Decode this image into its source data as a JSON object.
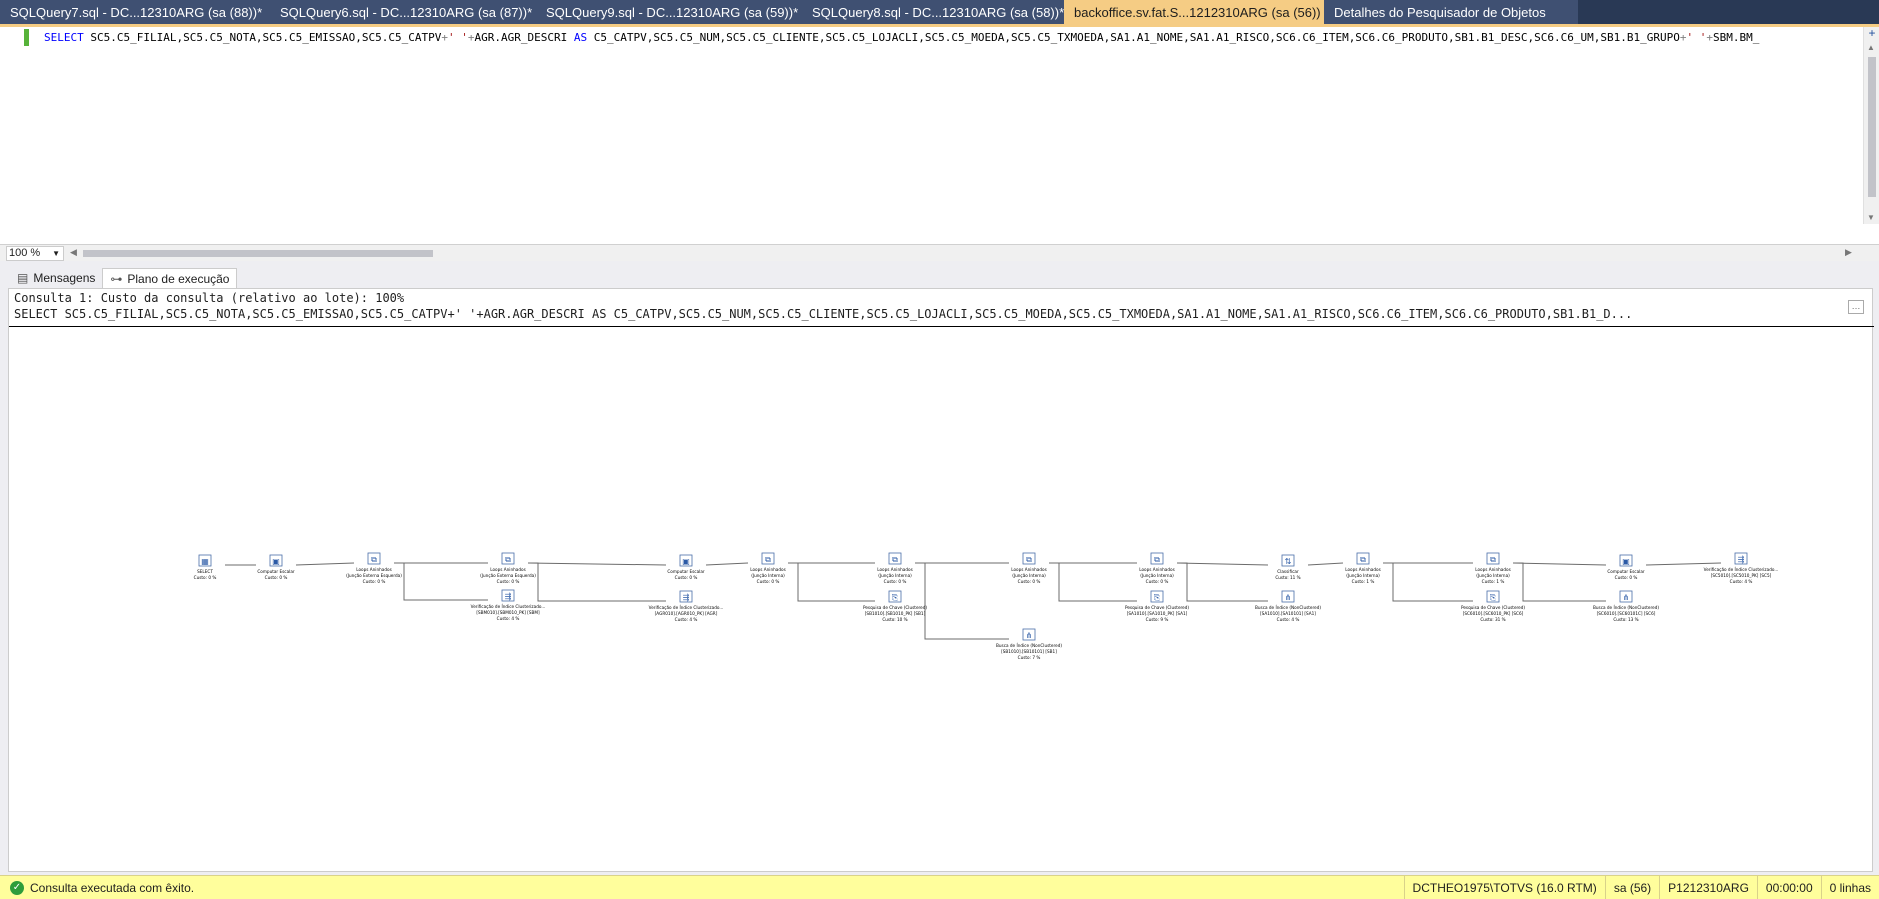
{
  "tabs": [
    {
      "label": "SQLQuery7.sql - DC...12310ARG (sa (88))*",
      "active": false
    },
    {
      "label": "SQLQuery6.sql - DC...12310ARG (sa (87))*",
      "active": false
    },
    {
      "label": "SQLQuery9.sql - DC...12310ARG (sa (59))*",
      "active": false
    },
    {
      "label": "SQLQuery8.sql - DC...12310ARG (sa (58))*",
      "active": false
    },
    {
      "label": "backoffice.sv.fat.S...1212310ARG (sa (56))",
      "active": true,
      "pin_icon": "pin-icon",
      "close_icon": "close-icon"
    },
    {
      "label": "Detalhes do Pesquisador de Objetos",
      "active": false
    }
  ],
  "editor": {
    "line1": {
      "kw_select": "SELECT",
      "part1": " SC5.C5_FILIAL,SC5.C5_NOTA,SC5.C5_EMISSAO,SC5.C5_CATPV",
      "plus1": "+",
      "str1": "' '",
      "plus2": "+",
      "part2": "AGR.AGR_DESCRI ",
      "kw_as": "AS",
      "part3": " C5_CATPV,SC5.C5_NUM,SC5.C5_CLIENTE,SC5.C5_LOJACLI,SC5.C5_MOEDA,SC5.C5_TXMOEDA,SA1.A1_NOME,SA1.A1_RISCO,SC6.C6_ITEM,SC6.C6_PRODUTO,SB1.B1_DESC,SC6.C6_UM,SB1.B1_GRUPO",
      "plus3": "+",
      "str2": "' '",
      "plus4": "+",
      "part4": "SBM.BM_"
    }
  },
  "zoom": {
    "value": "100 %"
  },
  "result_tabs": [
    {
      "label": "Mensagens",
      "icon": "messages-icon",
      "active": false
    },
    {
      "label": "Plano de execução",
      "icon": "execution-plan-icon",
      "active": true
    }
  ],
  "plan": {
    "header_line1": "Consulta 1: Custo da consulta (relativo ao lote): 100%",
    "header_line2": "SELECT SC5.C5_FILIAL,SC5.C5_NOTA,SC5.C5_EMISSAO,SC5.C5_CATPV+' '+AGR.AGR_DESCRI AS C5_CATPV,SC5.C5_NUM,SC5.C5_CLIENTE,SC5.C5_LOJACLI,SC5.C5_MOEDA,SC5.C5_TXMOEDA,SA1.A1_NOME,SA1.A1_RISCO,SC6.C6_ITEM,SC6.C6_PRODUTO,SB1.B1_D...",
    "nodes": [
      {
        "id": "n1",
        "icon": "select-icon",
        "lines": [
          "SELECT",
          "Custo: 0 %"
        ]
      },
      {
        "id": "n2",
        "icon": "compute-scalar-icon",
        "lines": [
          "Computar Escalar",
          "Custo: 0 %"
        ]
      },
      {
        "id": "n3",
        "icon": "nested-loops-icon",
        "lines": [
          "Loops Aninhados",
          "(Junção Externa Esquerda)",
          "Custo: 0 %"
        ]
      },
      {
        "id": "n4",
        "icon": "nested-loops-icon",
        "lines": [
          "Loops Aninhados",
          "(Junção Externa Esquerda)",
          "Custo: 0 %"
        ]
      },
      {
        "id": "n5",
        "icon": "clustered-index-scan-icon",
        "lines": [
          "Verificação de Índice Clusterizado...",
          "[SBM010].[SBM010_PK] [SBM]",
          "Custo: 4 %"
        ]
      },
      {
        "id": "n6",
        "icon": "compute-scalar-icon",
        "lines": [
          "Computar Escalar",
          "Custo: 0 %"
        ]
      },
      {
        "id": "n7",
        "icon": "clustered-index-scan-icon",
        "lines": [
          "Verificação de Índice Clusterizado...",
          "[AGR010].[AGR010_PK] [AGR]",
          "Custo: 4 %"
        ]
      },
      {
        "id": "n8",
        "icon": "nested-loops-icon",
        "lines": [
          "Loops Aninhados",
          "(Junção Interna)",
          "Custo: 0 %"
        ]
      },
      {
        "id": "n9",
        "icon": "nested-loops-icon",
        "lines": [
          "Loops Aninhados",
          "(Junção Interna)",
          "Custo: 0 %"
        ]
      },
      {
        "id": "n10",
        "icon": "key-lookup-icon",
        "lines": [
          "Pesquisa de Chave (Clustered)",
          "[SB1010].[SB1010_PK] [SB1]",
          "Custo: 10 %"
        ]
      },
      {
        "id": "n11",
        "icon": "nested-loops-icon",
        "lines": [
          "Loops Aninhados",
          "(Junção Interna)",
          "Custo: 0 %"
        ]
      },
      {
        "id": "n12",
        "icon": "index-seek-icon",
        "lines": [
          "Busca de Índice (NonClustered)",
          "[SB1010].[SB10101] [SB1]",
          "Custo: 7 %"
        ]
      },
      {
        "id": "n13",
        "icon": "nested-loops-icon",
        "lines": [
          "Loops Aninhados",
          "(Junção Interna)",
          "Custo: 0 %"
        ]
      },
      {
        "id": "n14",
        "icon": "key-lookup-icon",
        "lines": [
          "Pesquisa de Chave (Clustered)",
          "[SA1010].[SA1010_PK] [SA1]",
          "Custo: 9 %"
        ]
      },
      {
        "id": "n15",
        "icon": "sort-icon",
        "lines": [
          "Classificar",
          "Custo: 11 %"
        ]
      },
      {
        "id": "n16",
        "icon": "index-seek-icon",
        "lines": [
          "Busca de Índice (NonClustered)",
          "[SA1010].[SA10101] [SA1]",
          "Custo: 4 %"
        ]
      },
      {
        "id": "n17",
        "icon": "nested-loops-icon",
        "lines": [
          "Loops Aninhados",
          "(Junção Interna)",
          "Custo: 1 %"
        ]
      },
      {
        "id": "n18",
        "icon": "nested-loops-icon",
        "lines": [
          "Loops Aninhados",
          "(Junção Interna)",
          "Custo: 1 %"
        ]
      },
      {
        "id": "n19",
        "icon": "key-lookup-icon",
        "lines": [
          "Pesquisa de Chave (Clustered)",
          "[SC6010].[SC6010_PK] [SC6]",
          "Custo: 31 %"
        ]
      },
      {
        "id": "n20",
        "icon": "index-seek-icon",
        "lines": [
          "Busca de Índice (NonClustered)",
          "[SC6010].[SC60101C] [SC6]",
          "Custo: 13 %"
        ]
      },
      {
        "id": "n21",
        "icon": "compute-scalar-icon",
        "lines": [
          "Computar Escalar",
          "Custo: 0 %"
        ]
      },
      {
        "id": "n22",
        "icon": "clustered-index-scan-icon",
        "lines": [
          "Verificação de Índice Clusterizado...",
          "[SC5010].[SC5010_PK] [SC5]",
          "Custo: 4 %"
        ]
      }
    ]
  },
  "status": {
    "message": "Consulta executada com êxito.",
    "server": "DCTHEO1975\\TOTVS (16.0 RTM)",
    "user": "sa (56)",
    "database": "P1212310ARG",
    "elapsed": "00:00:00",
    "rows": "0 linhas"
  },
  "colors": {
    "tabstrip_bg": "#293955",
    "active_tab_bg": "#f5cc84",
    "statusbar_bg": "#fffe9c",
    "success_icon": "#2e9d3a",
    "keyword": "#0000ff",
    "string": "#a31515"
  }
}
